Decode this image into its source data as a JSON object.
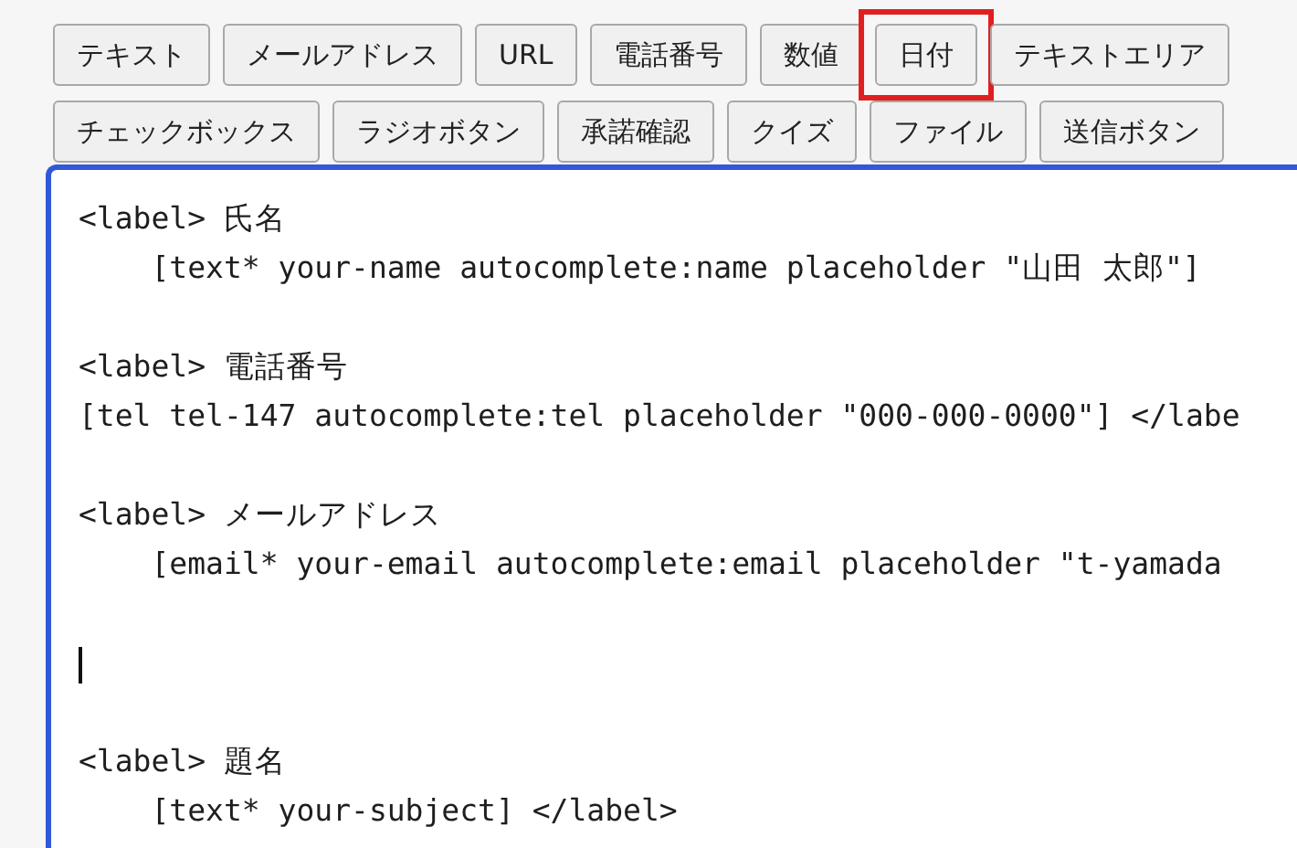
{
  "button_rows": [
    [
      {
        "label": "テキスト",
        "highlighted": false
      },
      {
        "label": "メールアドレス",
        "highlighted": false
      },
      {
        "label": "URL",
        "highlighted": false
      },
      {
        "label": "電話番号",
        "highlighted": false
      },
      {
        "label": "数値",
        "highlighted": false
      },
      {
        "label": "日付",
        "highlighted": true
      },
      {
        "label": "テキストエリア",
        "highlighted": false
      }
    ],
    [
      {
        "label": "チェックボックス",
        "highlighted": false
      },
      {
        "label": "ラジオボタン",
        "highlighted": false
      },
      {
        "label": "承諾確認",
        "highlighted": false
      },
      {
        "label": "クイズ",
        "highlighted": false
      },
      {
        "label": "ファイル",
        "highlighted": false
      },
      {
        "label": "送信ボタン",
        "highlighted": false
      }
    ]
  ],
  "editor": {
    "lines": [
      {
        "kind": "code",
        "text": "<label> 氏名"
      },
      {
        "kind": "code",
        "text": "    [text* your-name autocomplete:name placeholder \"山田 太郎\"]"
      },
      {
        "kind": "blank"
      },
      {
        "kind": "code",
        "text": "<label> 電話番号"
      },
      {
        "kind": "code",
        "text": "[tel tel-147 autocomplete:tel placeholder \"000-000-0000\"] </labe"
      },
      {
        "kind": "blank"
      },
      {
        "kind": "code",
        "text": "<label> メールアドレス"
      },
      {
        "kind": "code",
        "text": "    [email* your-email autocomplete:email placeholder \"t-yamada"
      },
      {
        "kind": "blank"
      },
      {
        "kind": "cursor"
      },
      {
        "kind": "blank"
      },
      {
        "kind": "code",
        "text": "<label> 題名"
      },
      {
        "kind": "code",
        "text": "    [text* your-subject] </label>"
      }
    ]
  }
}
